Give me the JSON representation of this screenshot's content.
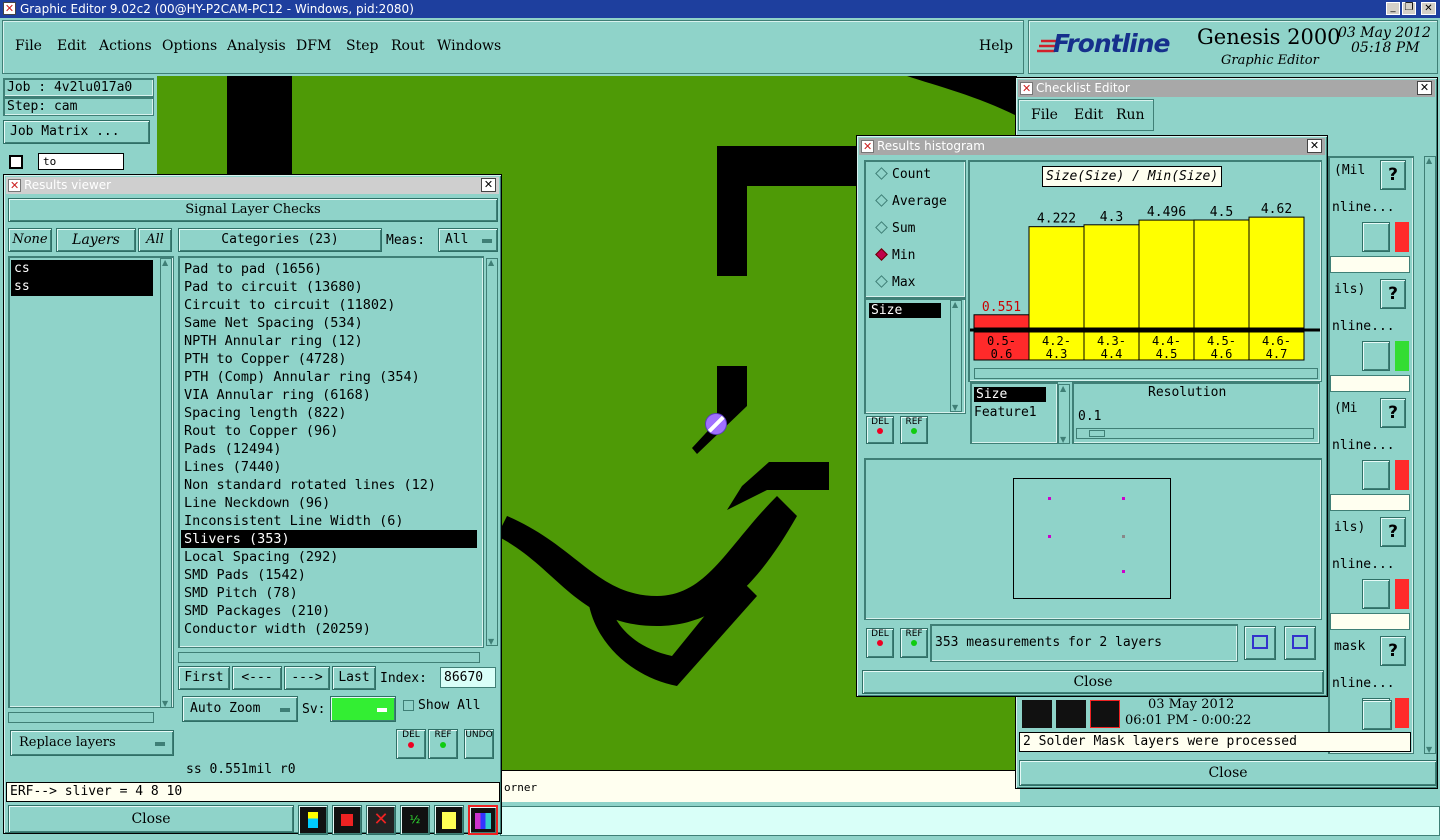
{
  "app": {
    "title": "Graphic Editor 9.02c2 (00@HY-P2CAM-PC12 - Windows, pid:2080)",
    "window_controls": [
      "_",
      "▫",
      "▭",
      "✕"
    ],
    "menu": [
      "File",
      "Edit",
      "Actions",
      "Options",
      "Analysis",
      "DFM",
      "Step",
      "Rout",
      "Windows"
    ],
    "help": "Help",
    "brand": "Frontline",
    "product": "Genesis 2000",
    "subtitle": "Graphic Editor",
    "date": "03 May 2012",
    "time": "05:18 PM"
  },
  "job_panel": {
    "job": "Job : 4v2lu017a0",
    "step": "Step: cam",
    "matrix": "Job Matrix ...",
    "to": "to"
  },
  "results_viewer": {
    "title": "Results viewer",
    "header": "Signal Layer Checks",
    "none": "None",
    "layers": "Layers",
    "all": "All",
    "categories_btn": "Categories (23)",
    "meas_label": "Meas:",
    "meas_value": "All",
    "layer_list": [
      "cs",
      "ss"
    ],
    "categories": [
      "Pad to pad (1656)",
      "Pad to circuit (13680)",
      "Circuit to circuit (11802)",
      "Same Net Spacing (534)",
      "NPTH Annular ring (12)",
      "PTH to Copper (4728)",
      "PTH (Comp) Annular ring (354)",
      "VIA Annular ring (6168)",
      "Spacing length (822)",
      "Rout to Copper (96)",
      "Pads (12494)",
      "Lines (7440)",
      "Non standard rotated lines (12)",
      "Line Neckdown (96)",
      "Inconsistent Line Width (6)",
      "Slivers (353)",
      "Local Spacing (292)",
      "SMD Pads (1542)",
      "SMD Pitch (78)",
      "SMD Packages (210)",
      "Conductor width (20259)"
    ],
    "selected_category": 15,
    "first": "First",
    "prev": "<---",
    "next": "--->",
    "last": "Last",
    "index_label": "Index:",
    "index_value": "86670",
    "auto_zoom": "Auto Zoom",
    "sv_label": "Sv:",
    "show_all": "Show All",
    "replace_layers": "Replace layers",
    "del": "DEL",
    "ref": "REF",
    "undo": "UNDO",
    "status": "ss 0.551mil  r0",
    "erf": "ERF--> sliver = 4 8 10",
    "close": "Close"
  },
  "canvas": {
    "corner_text": "orner"
  },
  "histogram": {
    "title": "Results histogram",
    "modes": [
      "Count",
      "Average",
      "Sum",
      "Min",
      "Max"
    ],
    "selected_mode": "Min",
    "chart_title": "Size(Size) / Min(Size)",
    "list_item": "Size",
    "del": "DEL",
    "ref": "REF",
    "field_list": [
      "Size",
      "Feature1"
    ],
    "resolution_label": "Resolution",
    "resolution_value": "0.1",
    "measurements": "353 measurements for 2 layers",
    "close": "Close"
  },
  "chart_data": {
    "type": "bar",
    "title": "Size(Size) / Min(Size)",
    "categories": [
      "0.5-0.6",
      "4.2-4.3",
      "4.3-4.4",
      "4.4-4.5",
      "4.5-4.6",
      "4.6-4.7"
    ],
    "values": [
      0.551,
      4.222,
      4.3,
      4.496,
      4.5,
      4.62
    ],
    "value_labels": [
      "0.551",
      "4.222",
      "4.3",
      "4.496",
      "4.5",
      "4.62"
    ],
    "category_labels": [
      [
        "0.5-",
        "0.6"
      ],
      [
        "4.2-",
        "4.3"
      ],
      [
        "4.3-",
        "4.4"
      ],
      [
        "4.4-",
        "4.5"
      ],
      [
        "4.5-",
        "4.6"
      ],
      [
        "4.6-",
        "4.7"
      ]
    ],
    "colors": [
      "#ff2a2a",
      "#ffff00",
      "#ffff00",
      "#ffff00",
      "#ffff00",
      "#ffff00"
    ],
    "ylim": [
      0,
      5
    ]
  },
  "checklist": {
    "title": "Checklist Editor",
    "menu": [
      "File",
      "Edit",
      "Run"
    ],
    "row_texts": [
      "(Mil",
      "nline...",
      "ils)",
      "nline...",
      "(Mi",
      "nline...",
      "ils)",
      "nline...",
      "mask",
      "nline..."
    ],
    "date": "03 May 2012",
    "time": "06:01 PM - 0:00:22",
    "status": "2 Solder Mask layers were processed",
    "close": "Close"
  },
  "colors": {
    "panel": "#8fd3c9",
    "canvas": "#4e9a06",
    "copper_void": "#000000",
    "highlight": "#ffff00",
    "error": "#ff2a2a",
    "brand_red": "#d1202a",
    "brand_blue": "#16308c"
  }
}
